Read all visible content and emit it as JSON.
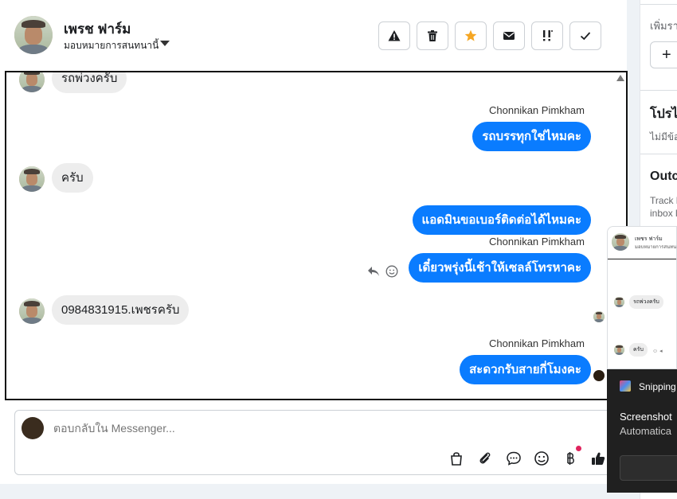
{
  "header": {
    "contact_name": "เพรช ฟาร์ม",
    "assign_label": "มอบหมายการสนทนานี้",
    "actions": [
      {
        "name": "report-spam-button",
        "icon": "warning-icon"
      },
      {
        "name": "delete-button",
        "icon": "trash-icon"
      },
      {
        "name": "star-button",
        "icon": "star-icon"
      },
      {
        "name": "mark-unread-button",
        "icon": "envelope-icon"
      },
      {
        "name": "follow-up-button",
        "icon": "double-exclamation-icon"
      },
      {
        "name": "mark-done-button",
        "icon": "check-icon"
      }
    ]
  },
  "chat": {
    "messages": [
      {
        "dir": "in",
        "text": "รถพ่วงครับ"
      },
      {
        "dir": "out",
        "sender": "Chonnikan Pimkham",
        "text": "รถบรรทุกใช่ไหมคะ"
      },
      {
        "dir": "in",
        "text": "ครับ"
      },
      {
        "dir": "out",
        "text": "แอดมินขอเบอร์ติดต่อได้ไหมคะ"
      },
      {
        "dir": "out",
        "sender": "Chonnikan Pimkham",
        "text": "เดี๋ยวพรุ่งนี้เช้าให้เซลล์โทรหาคะ"
      },
      {
        "dir": "in",
        "text": "0984831915.เพชรครับ"
      },
      {
        "dir": "out",
        "sender": "Chonnikan Pimkham",
        "text": "สะดวกรับสายกี่โมงคะ"
      }
    ]
  },
  "composer": {
    "placeholder": "ตอบกลับใน Messenger...",
    "icons": [
      "shopping-bag-icon",
      "paperclip-icon",
      "chat-bubble-icon",
      "emoji-icon",
      "baht-icon",
      "thumbs-up-icon"
    ]
  },
  "side": {
    "line1": "เพิ่มรา",
    "plus": "+",
    "profile_title": "โปรไ",
    "profile_text": "ไม่มีข้อ",
    "outcome_title": "Outc",
    "outcome_line1": "Track l",
    "outcome_line2": "inbox l"
  },
  "preview": {
    "name": "เพชร ฟาร์ม",
    "sub": "มอบหมายการสนทนา",
    "msg1": "รถพ่วงครับ",
    "msg2": "ครับ"
  },
  "toast": {
    "app": "Snipping",
    "title": "Screenshot",
    "body": "Automatica"
  },
  "colors": {
    "accent": "#0a7cff",
    "star": "#f5a623",
    "badge": "#e0245e"
  }
}
